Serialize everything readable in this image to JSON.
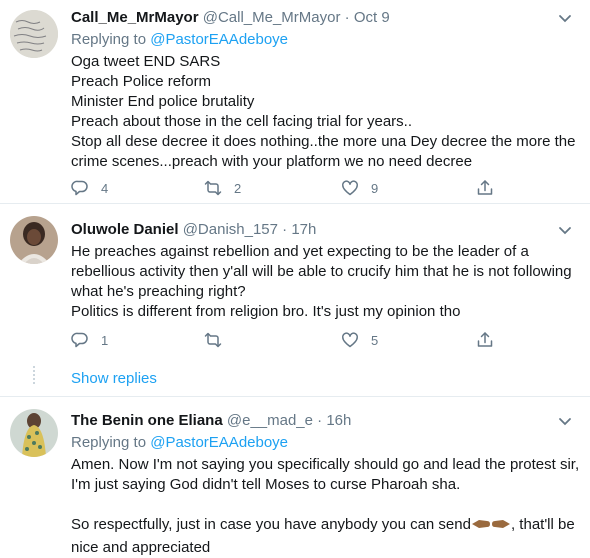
{
  "tweets": [
    {
      "name": "Call_Me_MrMayor",
      "handle": "@Call_Me_MrMayor",
      "dot": "·",
      "time": "Oct 9",
      "replying_label": "Replying to",
      "replying_handle": "@PastorEAAdeboye",
      "lines": [
        "Oga tweet END SARS",
        "Preach Police reform",
        "Minister End police brutality",
        "Preach about those in the cell facing trial for years..",
        "Stop all dese decree it does nothing..the more una Dey decree the more the crime scenes...preach with your platform we no need decree"
      ],
      "replies": "4",
      "retweets": "2",
      "likes": "9"
    },
    {
      "name": "Oluwole Daniel",
      "handle": "@Danish_157",
      "dot": "·",
      "time": "17h",
      "lines": [
        "He preaches against rebellion and yet expecting to be the leader of a rebellious activity then y'all will be able to crucify him that he is not following what he's preaching right?",
        "Politics is different from religion bro. It's just my opinion tho"
      ],
      "replies": "1",
      "retweets": "",
      "likes": "5"
    },
    {
      "name": "The Benin one Eliana",
      "handle": "@e__mad_e",
      "dot": "·",
      "time": "16h",
      "replying_label": "Replying to",
      "replying_handle": "@PastorEAAdeboye",
      "line1": "Amen. Now I'm not saying you specifically should go and lead the protest sir, I'm just saying God didn't tell Moses to curse Pharoah sha.",
      "line2_before": "So respectfully, just in case you have anybody you can send",
      "line2_after": ", that'll be nice and appreciated"
    }
  ],
  "show_replies": "Show replies",
  "icons": {
    "reply": "reply-icon",
    "retweet": "retweet-icon",
    "like": "heart-icon",
    "share": "share-icon",
    "caret": "chevron-down-icon",
    "emoji": "backhand-index-pointing-left-and-right-emoji"
  },
  "colors": {
    "link": "#1da1f2",
    "secondary": "#657786",
    "divider": "#e6ecf0"
  }
}
